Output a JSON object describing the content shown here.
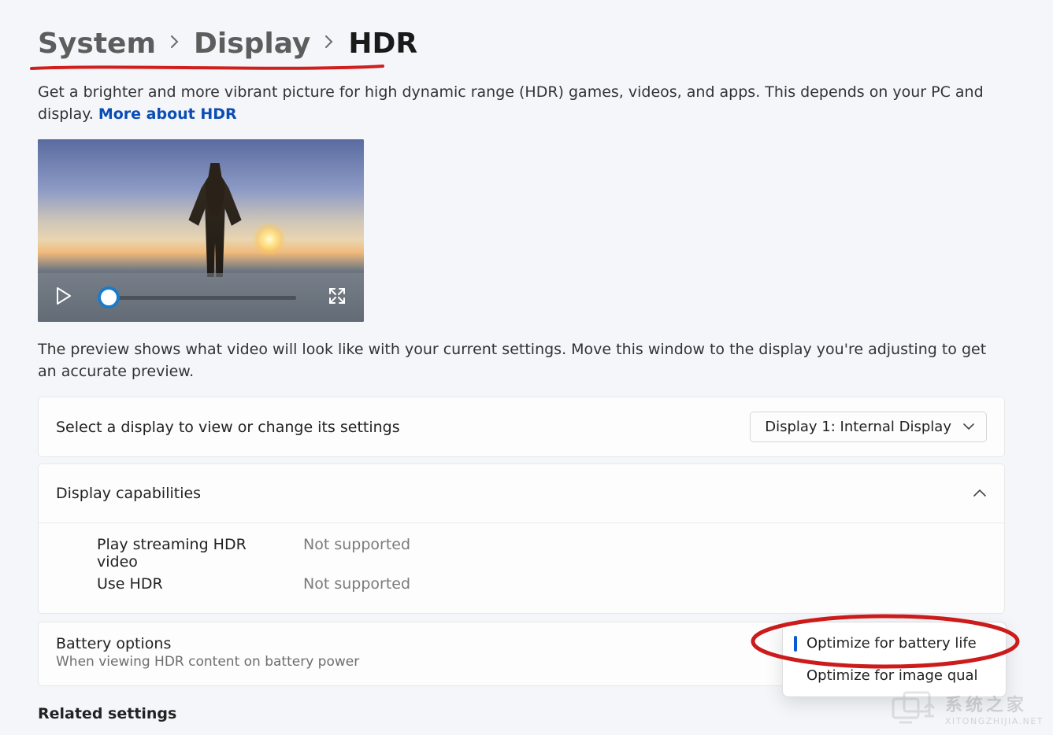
{
  "breadcrumb": {
    "level1": "System",
    "level2": "Display",
    "level3": "HDR"
  },
  "description": {
    "text_before_link": "Get a brighter and more vibrant picture for high dynamic range (HDR) games, videos, and apps. This depends on your PC and display. ",
    "link_text": "More about HDR"
  },
  "preview_note": "The preview shows what video will look like with your current settings. Move this window to the display you're adjusting to get an accurate preview.",
  "display_selector": {
    "label": "Select a display to view or change its settings",
    "selected": "Display 1: Internal Display"
  },
  "capabilities": {
    "header_label": "Display capabilities",
    "rows": [
      {
        "label": "Play streaming HDR video",
        "value": "Not supported"
      },
      {
        "label": "Use HDR",
        "value": "Not supported"
      }
    ]
  },
  "battery": {
    "title": "Battery options",
    "subtitle": "When viewing HDR content on battery power",
    "menu": {
      "option1": "Optimize for battery life",
      "option2": "Optimize for image qual"
    }
  },
  "related_heading": "Related settings",
  "watermark": {
    "cn": "系统之家",
    "en": "XITONGZHIJIA.NET"
  }
}
